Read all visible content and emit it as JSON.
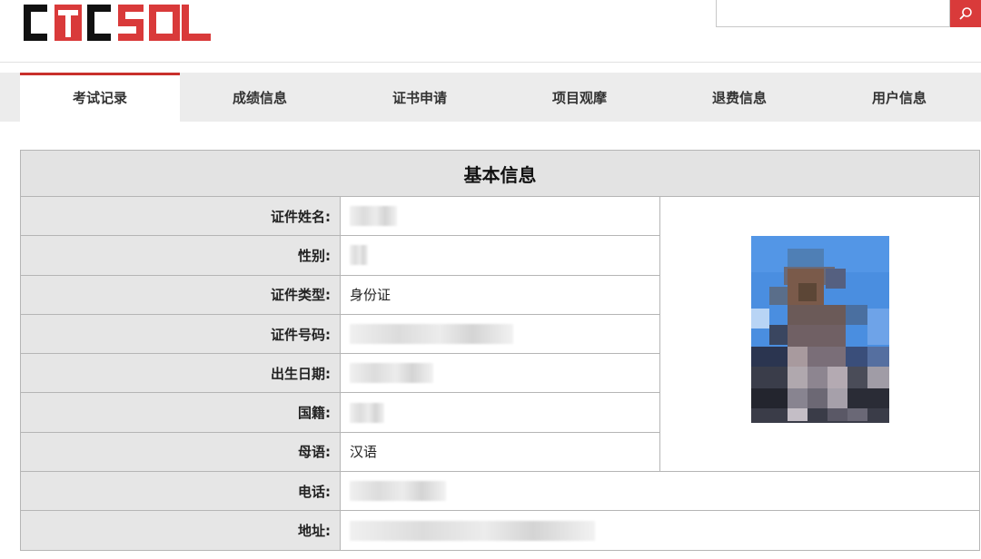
{
  "header": {
    "logo_text": "CTCSOL",
    "brand_color": "#d93a3a",
    "search": {
      "placeholder": "",
      "icon": "search-icon"
    }
  },
  "nav": {
    "items": [
      {
        "label": "考试记录",
        "active": true
      },
      {
        "label": "成绩信息",
        "active": false
      },
      {
        "label": "证书申请",
        "active": false
      },
      {
        "label": "项目观摩",
        "active": false
      },
      {
        "label": "退费信息",
        "active": false
      },
      {
        "label": "用户信息",
        "active": false
      }
    ]
  },
  "basic_info": {
    "title": "基本信息",
    "rows": [
      {
        "label": "证件姓名:",
        "value": "",
        "redacted": true
      },
      {
        "label": "性别:",
        "value": "",
        "redacted": true
      },
      {
        "label": "证件类型:",
        "value": "身份证",
        "redacted": false
      },
      {
        "label": "证件号码:",
        "value": "",
        "redacted": true
      },
      {
        "label": "出生日期:",
        "value": "",
        "redacted": true
      },
      {
        "label": "国籍:",
        "value": "",
        "redacted": true
      },
      {
        "label": "母语:",
        "value": "汉语",
        "redacted": false
      },
      {
        "label": "电话:",
        "value": "",
        "redacted": true
      },
      {
        "label": "地址:",
        "value": "",
        "redacted": true
      }
    ],
    "photo": {
      "blurred": true
    }
  }
}
